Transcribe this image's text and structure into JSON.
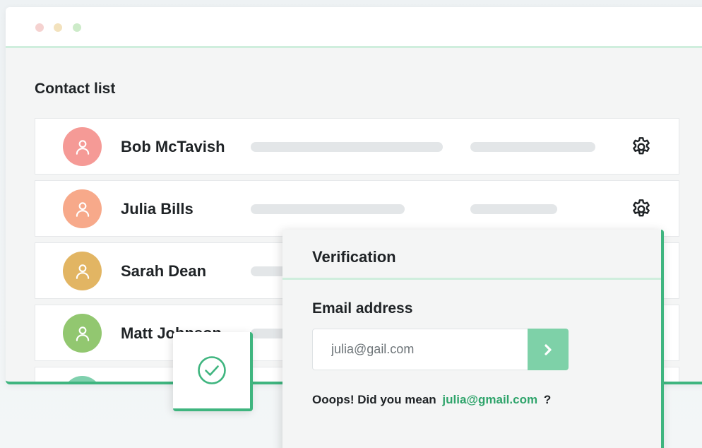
{
  "window": {
    "title": "Contact list"
  },
  "contacts": [
    {
      "name": "Bob McTavish",
      "avatar_color": "#f59a96"
    },
    {
      "name": "Julia Bills",
      "avatar_color": "#f7a98a"
    },
    {
      "name": "Sarah Dean",
      "avatar_color": "#e2b563"
    },
    {
      "name": "Matt Johnson",
      "avatar_color": "#92c770"
    },
    {
      "name": "",
      "avatar_color": "#7fd0ad"
    }
  ],
  "icons": {
    "avatar": "user-icon",
    "settings": "gear-icon",
    "submit": "chevron-right-icon",
    "success": "check-circle-icon"
  },
  "verification": {
    "title": "Verification",
    "email_label": "Email address",
    "email_value": "julia@gail.com",
    "suggestion_prefix": "Ooops! Did you mean",
    "suggestion_email": "julia@gmail.com",
    "suggestion_suffix": "?"
  },
  "colors": {
    "accent": "#3fb57f",
    "accent_light": "#cfeedd",
    "button": "#7ed1a8",
    "link": "#2fa46b"
  }
}
